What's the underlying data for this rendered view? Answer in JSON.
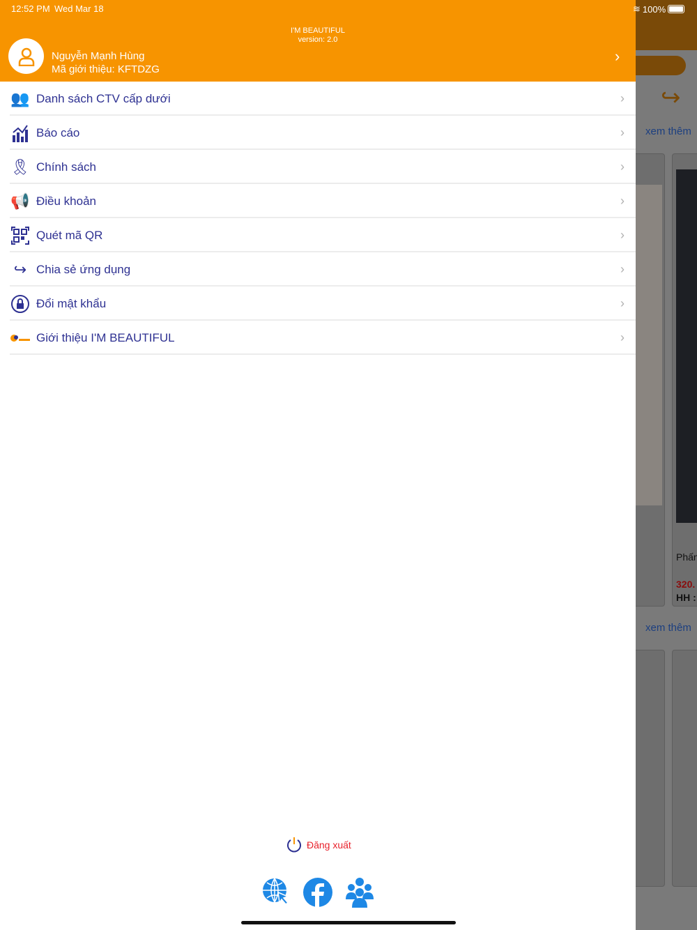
{
  "status_bar": {
    "time": "12:52 PM",
    "date": "Wed Mar 18",
    "battery": "100%"
  },
  "header": {
    "app_name": "I'M BEAUTIFUL",
    "version": "version: 2.0",
    "user_name": "Nguyễn Mạnh Hùng",
    "referral": "Mã giới thiệu: KFTDZG"
  },
  "menu": [
    {
      "label": "Danh sách CTV cấp dưới",
      "icon": "users-icon"
    },
    {
      "label": "Báo cáo",
      "icon": "chart-icon"
    },
    {
      "label": "Chính sách",
      "icon": "ribbon-icon"
    },
    {
      "label": "Điều khoản",
      "icon": "megaphone-icon"
    },
    {
      "label": "Quét mã QR",
      "icon": "qr-icon"
    },
    {
      "label": "Chia sẻ ứng dụng",
      "icon": "share-icon"
    },
    {
      "label": "Đổi mật khẩu",
      "icon": "lock-icon"
    },
    {
      "label": "Giới thiệu I'M BEAUTIFUL",
      "icon": "logo-icon"
    }
  ],
  "logout": {
    "label": "Đăng xuất"
  },
  "background": {
    "see_more": "xem thêm",
    "product_name": "Phấn",
    "price": "320.",
    "commission": "HH :"
  },
  "colors": {
    "accent": "#f79400",
    "menu_text": "#2e3192",
    "logout": "#e8202a",
    "social": "#1e88e5"
  }
}
